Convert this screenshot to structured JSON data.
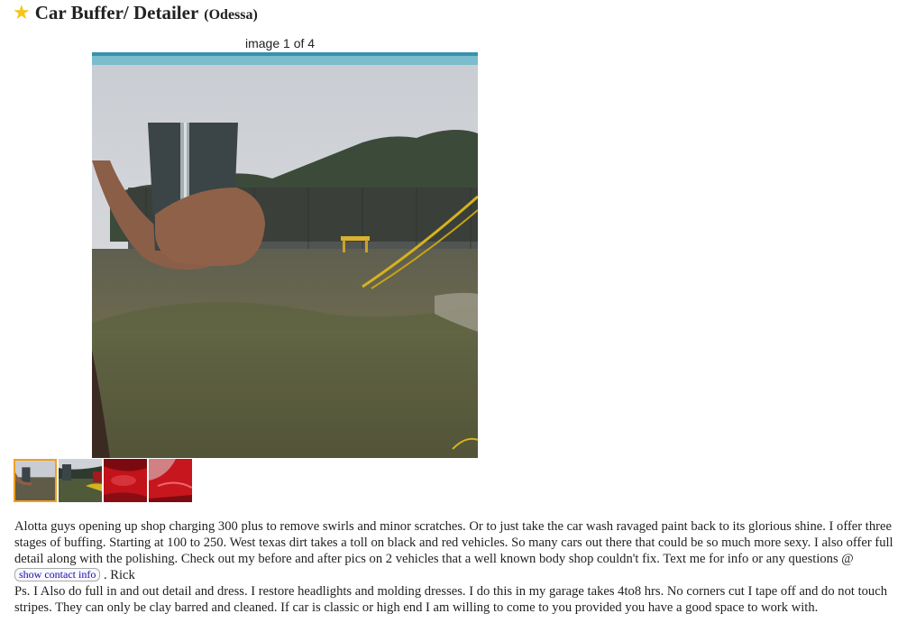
{
  "header": {
    "star_glyph": "★",
    "title": "Car Buffer/ Detailer",
    "location": "(Odessa)"
  },
  "gallery": {
    "counter": "image 1 of 4",
    "thumbnails": [
      "thumb-1",
      "thumb-2",
      "thumb-3",
      "thumb-4"
    ],
    "active_index": 1
  },
  "body": {
    "paragraph1_before": "Alotta guys opening up shop charging 300 plus to remove swirls and minor scratches. Or to just take the car wash ravaged paint back to its glorious shine. I offer three stages of buffing. Starting at 100 to 250. West texas dirt takes a toll on black and red vehicles. So many cars out there that could be so much more sexy. I also offer full detail along with the polishing. Check out my before and after pics on 2 vehicles that a well known body shop couldn't fix. Text me for info or any questions @",
    "contact_button": "show contact info",
    "paragraph1_after": ". Rick",
    "paragraph2": "Ps. I Also do full in and out detail and dress. I restore headlights and molding dresses. I do this in my garage takes 4to8 hrs. No corners cut I tape off and do not touch stripes. They can only be clay barred and cleaned. If car is classic or high end I am willing to come to you provided you have a good space to work with."
  },
  "colors": {
    "star": "#f5c518",
    "active_thumb_border": "#f0a020",
    "link": "#1a0dab"
  }
}
